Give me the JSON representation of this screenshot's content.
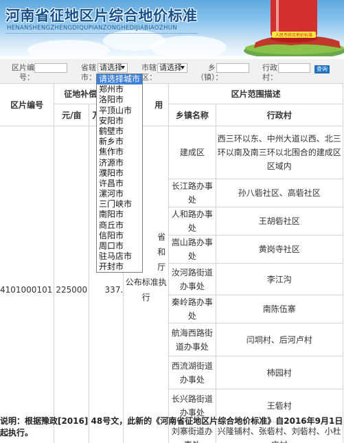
{
  "banner": {
    "title": "河南省征地区片综合地价标准",
    "subtitle": "HENANSHENGZHENGDIQUPIANZONGHEDIJIABIAOZHUN",
    "emblem_text": "人民币综合地价标准"
  },
  "search": {
    "zone_label": "区片编号：",
    "city_label": "省辖市：",
    "city_value": "请选择",
    "county_label": "市辖区：",
    "county_value": "请选择",
    "town_label": "乡（镇）：",
    "village_label": "行政村：",
    "button_label": "查询"
  },
  "dropdown": {
    "options": [
      "请选择城市",
      "郑州市",
      "洛阳市",
      "平顶山市",
      "安阳市",
      "鹤壁市",
      "新乡市",
      "焦作市",
      "济源市",
      "濮阳市",
      "许昌市",
      "漯河市",
      "三门峡市",
      "南阳市",
      "商丘市",
      "信阳市",
      "周口市",
      "驻马店市",
      "开封市"
    ]
  },
  "table": {
    "headers": {
      "zone_no": "区片编号",
      "comp_group": "征地补偿安置",
      "price": "元/亩",
      "price2": "万元/亩",
      "usage": "用",
      "range": "区片范围描述",
      "town": "乡镇名称",
      "village": "行政村"
    },
    "record": {
      "zone_no": "4101000101",
      "price": "225000",
      "price2": "337.",
      "note_line1": "省",
      "note_line2": "和",
      "note_line3": "厅",
      "note_line4": "公布标准执",
      "note_line5": "行"
    },
    "rows": [
      {
        "town": "建成区",
        "village": "西三环以东、中州大道以西、北三环以南及南三环以北围合的建成区区域内"
      },
      {
        "town": "长江路办事处",
        "village": "孙八砦社区、高砦社区"
      },
      {
        "town": "人和路办事处",
        "village": "王胡砦社区"
      },
      {
        "town": "嵩山路办事处",
        "village": "黄岗寺社区"
      },
      {
        "town": "汝河路街道办事处",
        "village": "李江沟"
      },
      {
        "town": "秦岭路办事处",
        "village": "南陈伍寨"
      },
      {
        "town": "航海西路街道办事处",
        "village": "闫垌村、后河卢村"
      },
      {
        "town": "西流湖街道办事处",
        "village": "柿园村"
      },
      {
        "town": "长兴路街道办事处",
        "village": "王砦村"
      },
      {
        "town": "刘寨街道办事处",
        "village": "兴隆铺村、张砦村、刘砦村、小杜庄村"
      }
    ]
  },
  "footer": {
    "note": "说明：根据豫政[2016] 48号文，此新的《河南省征地区片综合地价标准》自2016年9月1日起执行。"
  }
}
